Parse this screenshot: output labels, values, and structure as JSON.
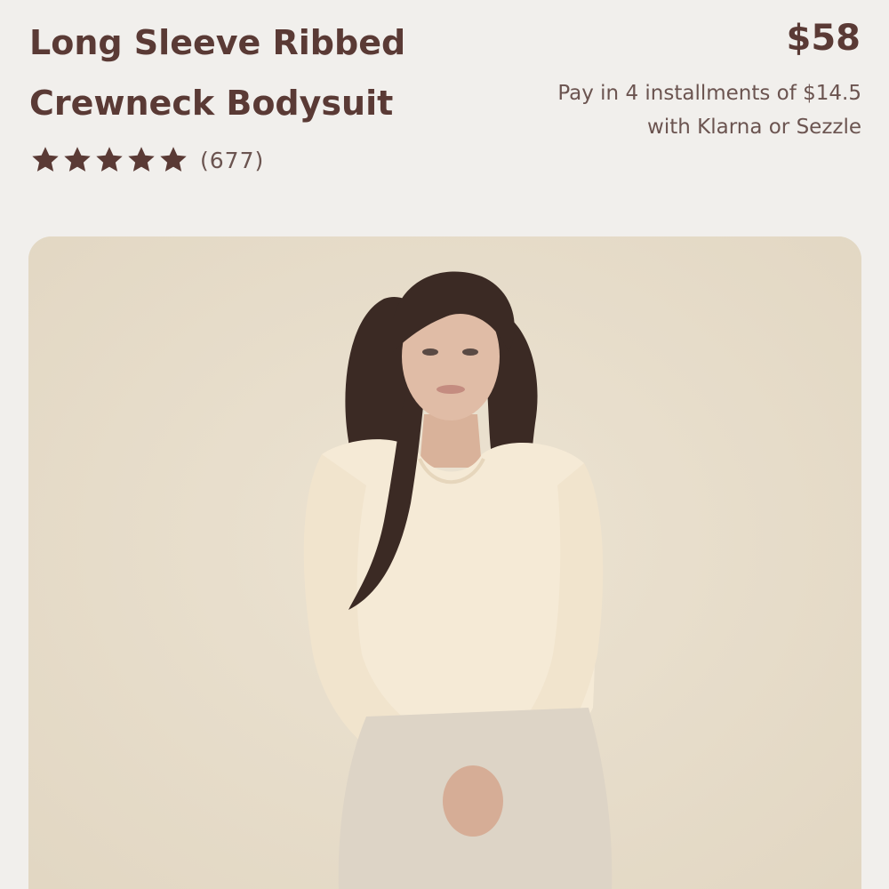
{
  "product": {
    "title_line1": "Long Sleeve Ribbed",
    "title_line2": "Crewneck Bodysuit",
    "price": "$58",
    "installments_line1": "Pay in 4 installments of $14.5",
    "installments_line2": "with Klarna or Sezzle",
    "rating_stars": 5,
    "review_count": "(677)",
    "image_alt": "Model wearing cream long sleeve ribbed crewneck bodysuit with beige jeans"
  },
  "colors": {
    "brand_text": "#5a3a35",
    "secondary_text": "#6b5450",
    "page_bg": "#f1efec",
    "photo_bg": "#e6dcc9",
    "star": "#5a3a35"
  },
  "icons": {
    "star": "star-icon"
  }
}
